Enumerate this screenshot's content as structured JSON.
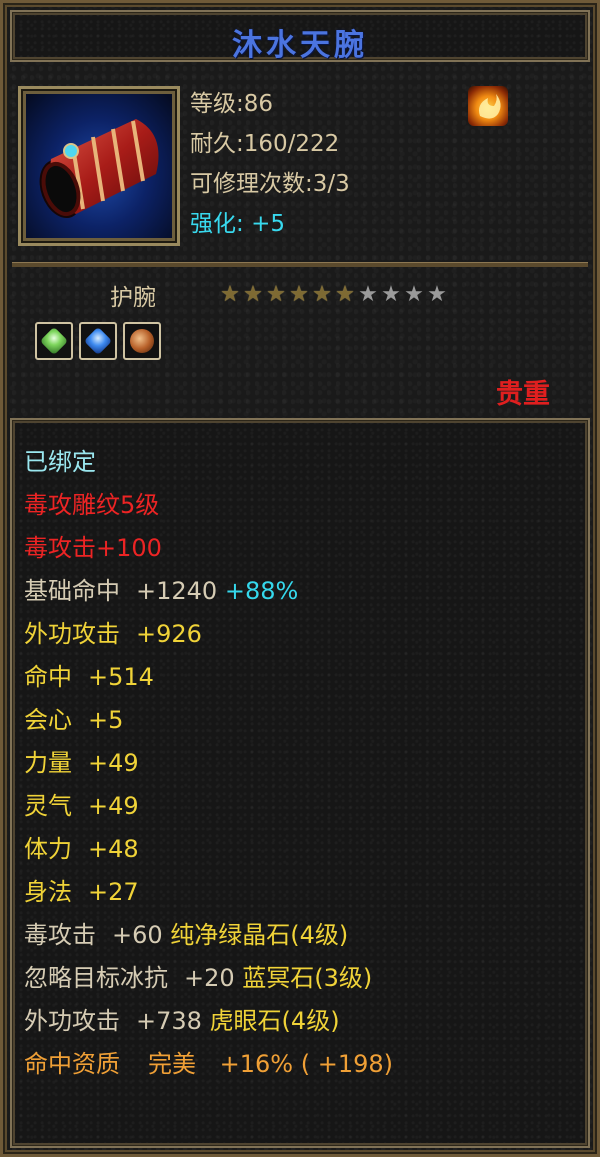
{
  "item": {
    "name": "沐水天腕",
    "level": "等级:86",
    "durability": "耐久:160/222",
    "repairs": "可修理次数:3/3",
    "enhance_label": "强化:",
    "enhance_value": "+5",
    "type": "护腕",
    "stars_lit": 6,
    "stars_total": 10,
    "quality": "贵重",
    "element_icon": "fire-element-icon",
    "gems": [
      "green-crystal-gem",
      "blue-crystal-gem",
      "brown-tiger-eye-gem"
    ]
  },
  "attributes": [
    {
      "label": "已绑定",
      "color": "cyan"
    },
    {
      "label": "毒攻雕纹5级",
      "color": "red"
    },
    {
      "label": "毒攻击+100",
      "color": "red"
    },
    {
      "label": "基础命中",
      "value": "+1240",
      "extra": "+88%",
      "color": "white"
    },
    {
      "label": "外功攻击",
      "value": "+926",
      "color": "yellow"
    },
    {
      "label": "命中",
      "value": "+514",
      "color": "yellow"
    },
    {
      "label": "会心",
      "value": "+5",
      "color": "yellow"
    },
    {
      "label": "力量",
      "value": "+49",
      "color": "yellow"
    },
    {
      "label": "灵气",
      "value": "+49",
      "color": "yellow"
    },
    {
      "label": "体力",
      "value": "+48",
      "color": "yellow"
    },
    {
      "label": "身法",
      "value": "+27",
      "color": "yellow"
    },
    {
      "label": "毒攻击",
      "value": "+60",
      "gem": "纯净绿晶石(4级)",
      "color": "white"
    },
    {
      "label": "忽略目标冰抗",
      "value": "+20",
      "gem": "蓝冥石(3级)",
      "color": "white"
    },
    {
      "label": "外功攻击",
      "value": "+738",
      "gem": "虎眼石(4级)",
      "color": "white"
    },
    {
      "label": "命中资质",
      "grade": "完美",
      "value": "+16%",
      "extra": "( +198)",
      "color": "orange"
    }
  ],
  "colors": {
    "title_blue": "#4b74e0",
    "enhance_cyan": "#38d9ee",
    "quality_red": "#e01f1f",
    "stat_yellow": "#f0d338",
    "aptitude_orange": "#f0a036"
  }
}
